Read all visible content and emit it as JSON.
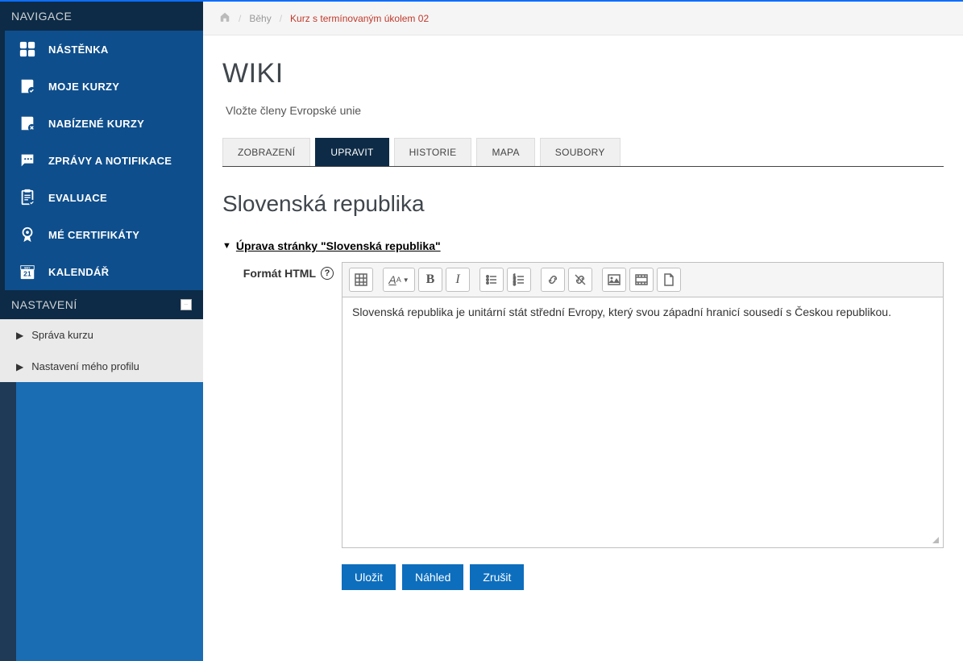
{
  "sidebar": {
    "nav_heading": "NAVIGACE",
    "items": [
      {
        "label": "NÁSTĚNKA",
        "icon": "dashboard"
      },
      {
        "label": "MOJE KURZY",
        "icon": "book-check"
      },
      {
        "label": "NABÍZENÉ KURZY",
        "icon": "book-x"
      },
      {
        "label": "ZPRÁVY A NOTIFIKACE",
        "icon": "chat"
      },
      {
        "label": "EVALUACE",
        "icon": "clipboard"
      },
      {
        "label": "MÉ CERTIFIKÁTY",
        "icon": "award"
      },
      {
        "label": "KALENDÁŘ",
        "icon": "calendar",
        "calendar_day": "21",
        "calendar_month": "MAY"
      }
    ],
    "settings_heading": "NASTAVENÍ",
    "settings_items": [
      {
        "label": "Správa kurzu"
      },
      {
        "label": "Nastavení mého profilu"
      }
    ]
  },
  "breadcrumb": {
    "items": [
      {
        "type": "home"
      },
      {
        "type": "link",
        "label": "Běhy"
      },
      {
        "type": "active",
        "label": "Kurz s termínovaným úkolem 02"
      }
    ]
  },
  "page": {
    "title": "WIKI",
    "subtitle": "Vložte členy Evropské unie"
  },
  "tabs": [
    {
      "label": "ZOBRAZENÍ",
      "active": false
    },
    {
      "label": "UPRAVIT",
      "active": true
    },
    {
      "label": "HISTORIE",
      "active": false
    },
    {
      "label": "MAPA",
      "active": false
    },
    {
      "label": "SOUBORY",
      "active": false
    }
  ],
  "section": {
    "title": "Slovenská republika",
    "collapse_label": "Úprava stránky \"Slovenská republika\""
  },
  "form": {
    "format_label": "Formát HTML",
    "editor_content": "Slovenská republika je unitární stát střední Evropy, který svou západní hranicí sousedí s Českou republikou."
  },
  "toolbar_groups": [
    [
      {
        "icon": "grid"
      }
    ],
    [
      {
        "icon": "font-drop"
      },
      {
        "icon": "bold"
      },
      {
        "icon": "italic"
      }
    ],
    [
      {
        "icon": "list-ul"
      },
      {
        "icon": "list-ol"
      }
    ],
    [
      {
        "icon": "link"
      },
      {
        "icon": "unlink"
      }
    ],
    [
      {
        "icon": "image"
      },
      {
        "icon": "video"
      },
      {
        "icon": "file"
      }
    ]
  ],
  "buttons": {
    "save": "Uložit",
    "preview": "Náhled",
    "cancel": "Zrušit"
  }
}
